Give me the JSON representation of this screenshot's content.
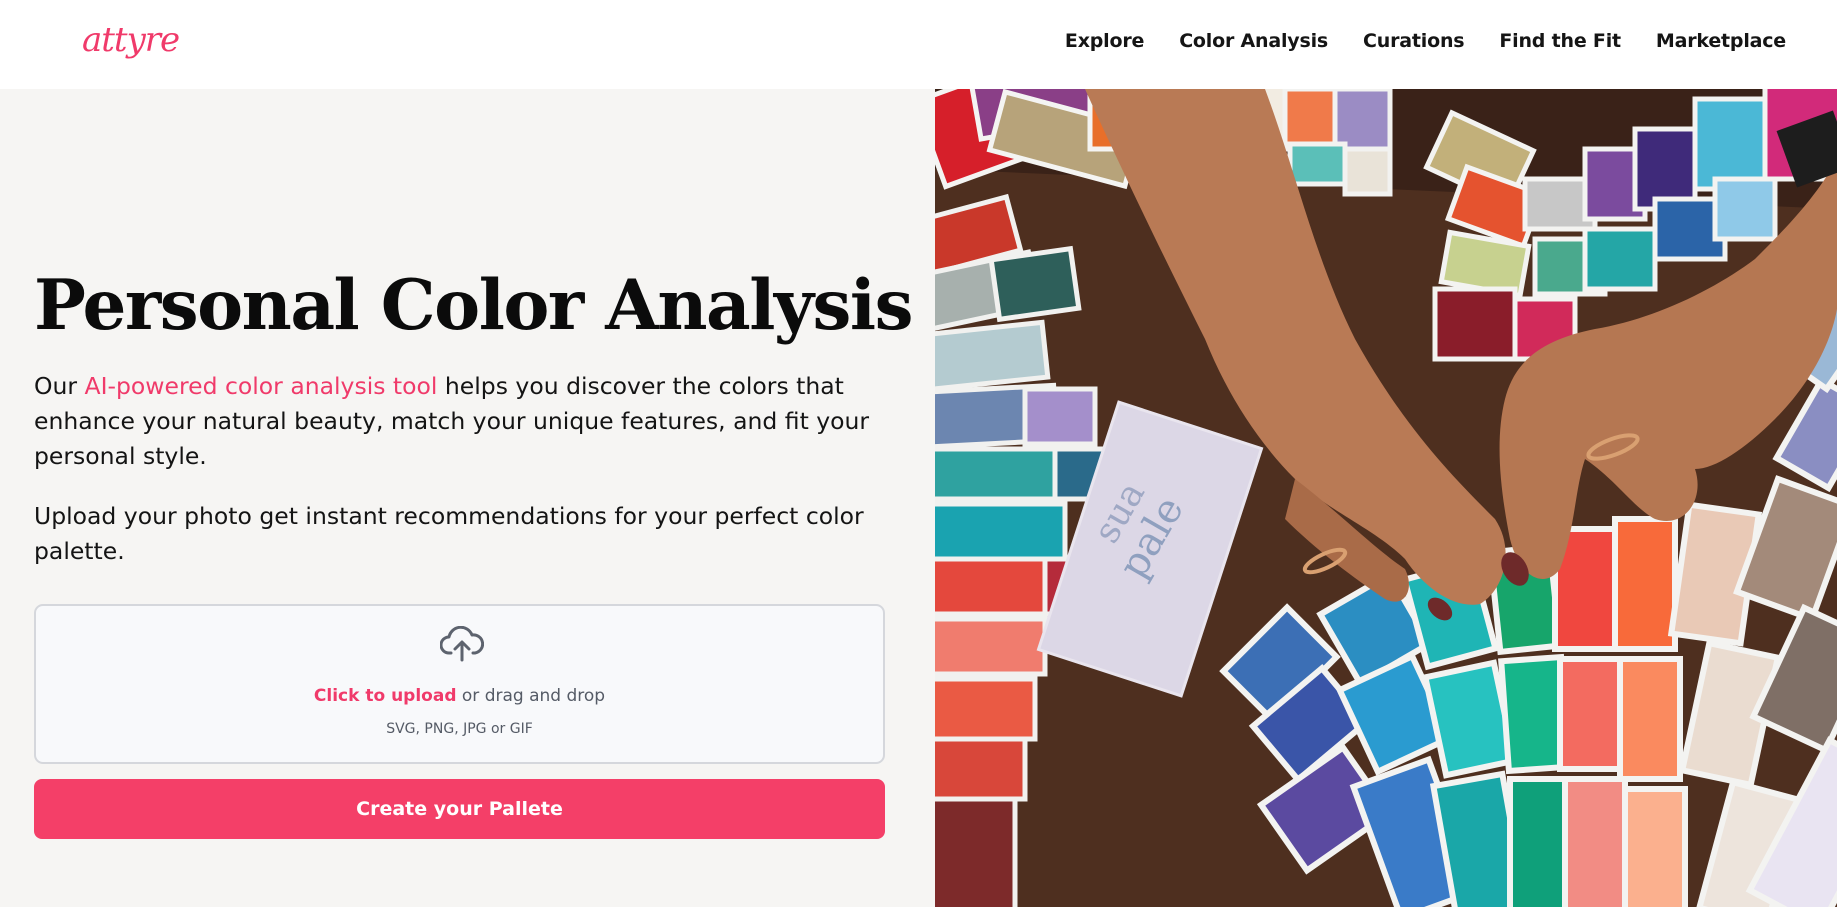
{
  "brand": {
    "logo_text": "attyre",
    "accent_color": "#f03a6a"
  },
  "nav": {
    "items": [
      "Explore",
      "Color Analysis",
      "Curations",
      "Find the Fit",
      "Marketplace"
    ]
  },
  "hero": {
    "title": "Personal Color Analysis",
    "intro_before": "Our ",
    "intro_link": "AI-powered color analysis tool",
    "intro_after": " helps you discover the colors that enhance your natural beauty, match your unique features, and fit your personal style.",
    "upload_text": "Upload your photo get instant recommendations for your perfect color palette."
  },
  "upload": {
    "icon": "cloud-upload-icon",
    "click_label": "Click to upload",
    "drag_text": " or drag and drop",
    "file_types": "SVG, PNG, JPG or GIF"
  },
  "cta": {
    "label": "Create your Pallete",
    "color": "#f43f68"
  },
  "photo": {
    "swatch_text_1": "sua",
    "swatch_text_2": "pale"
  }
}
